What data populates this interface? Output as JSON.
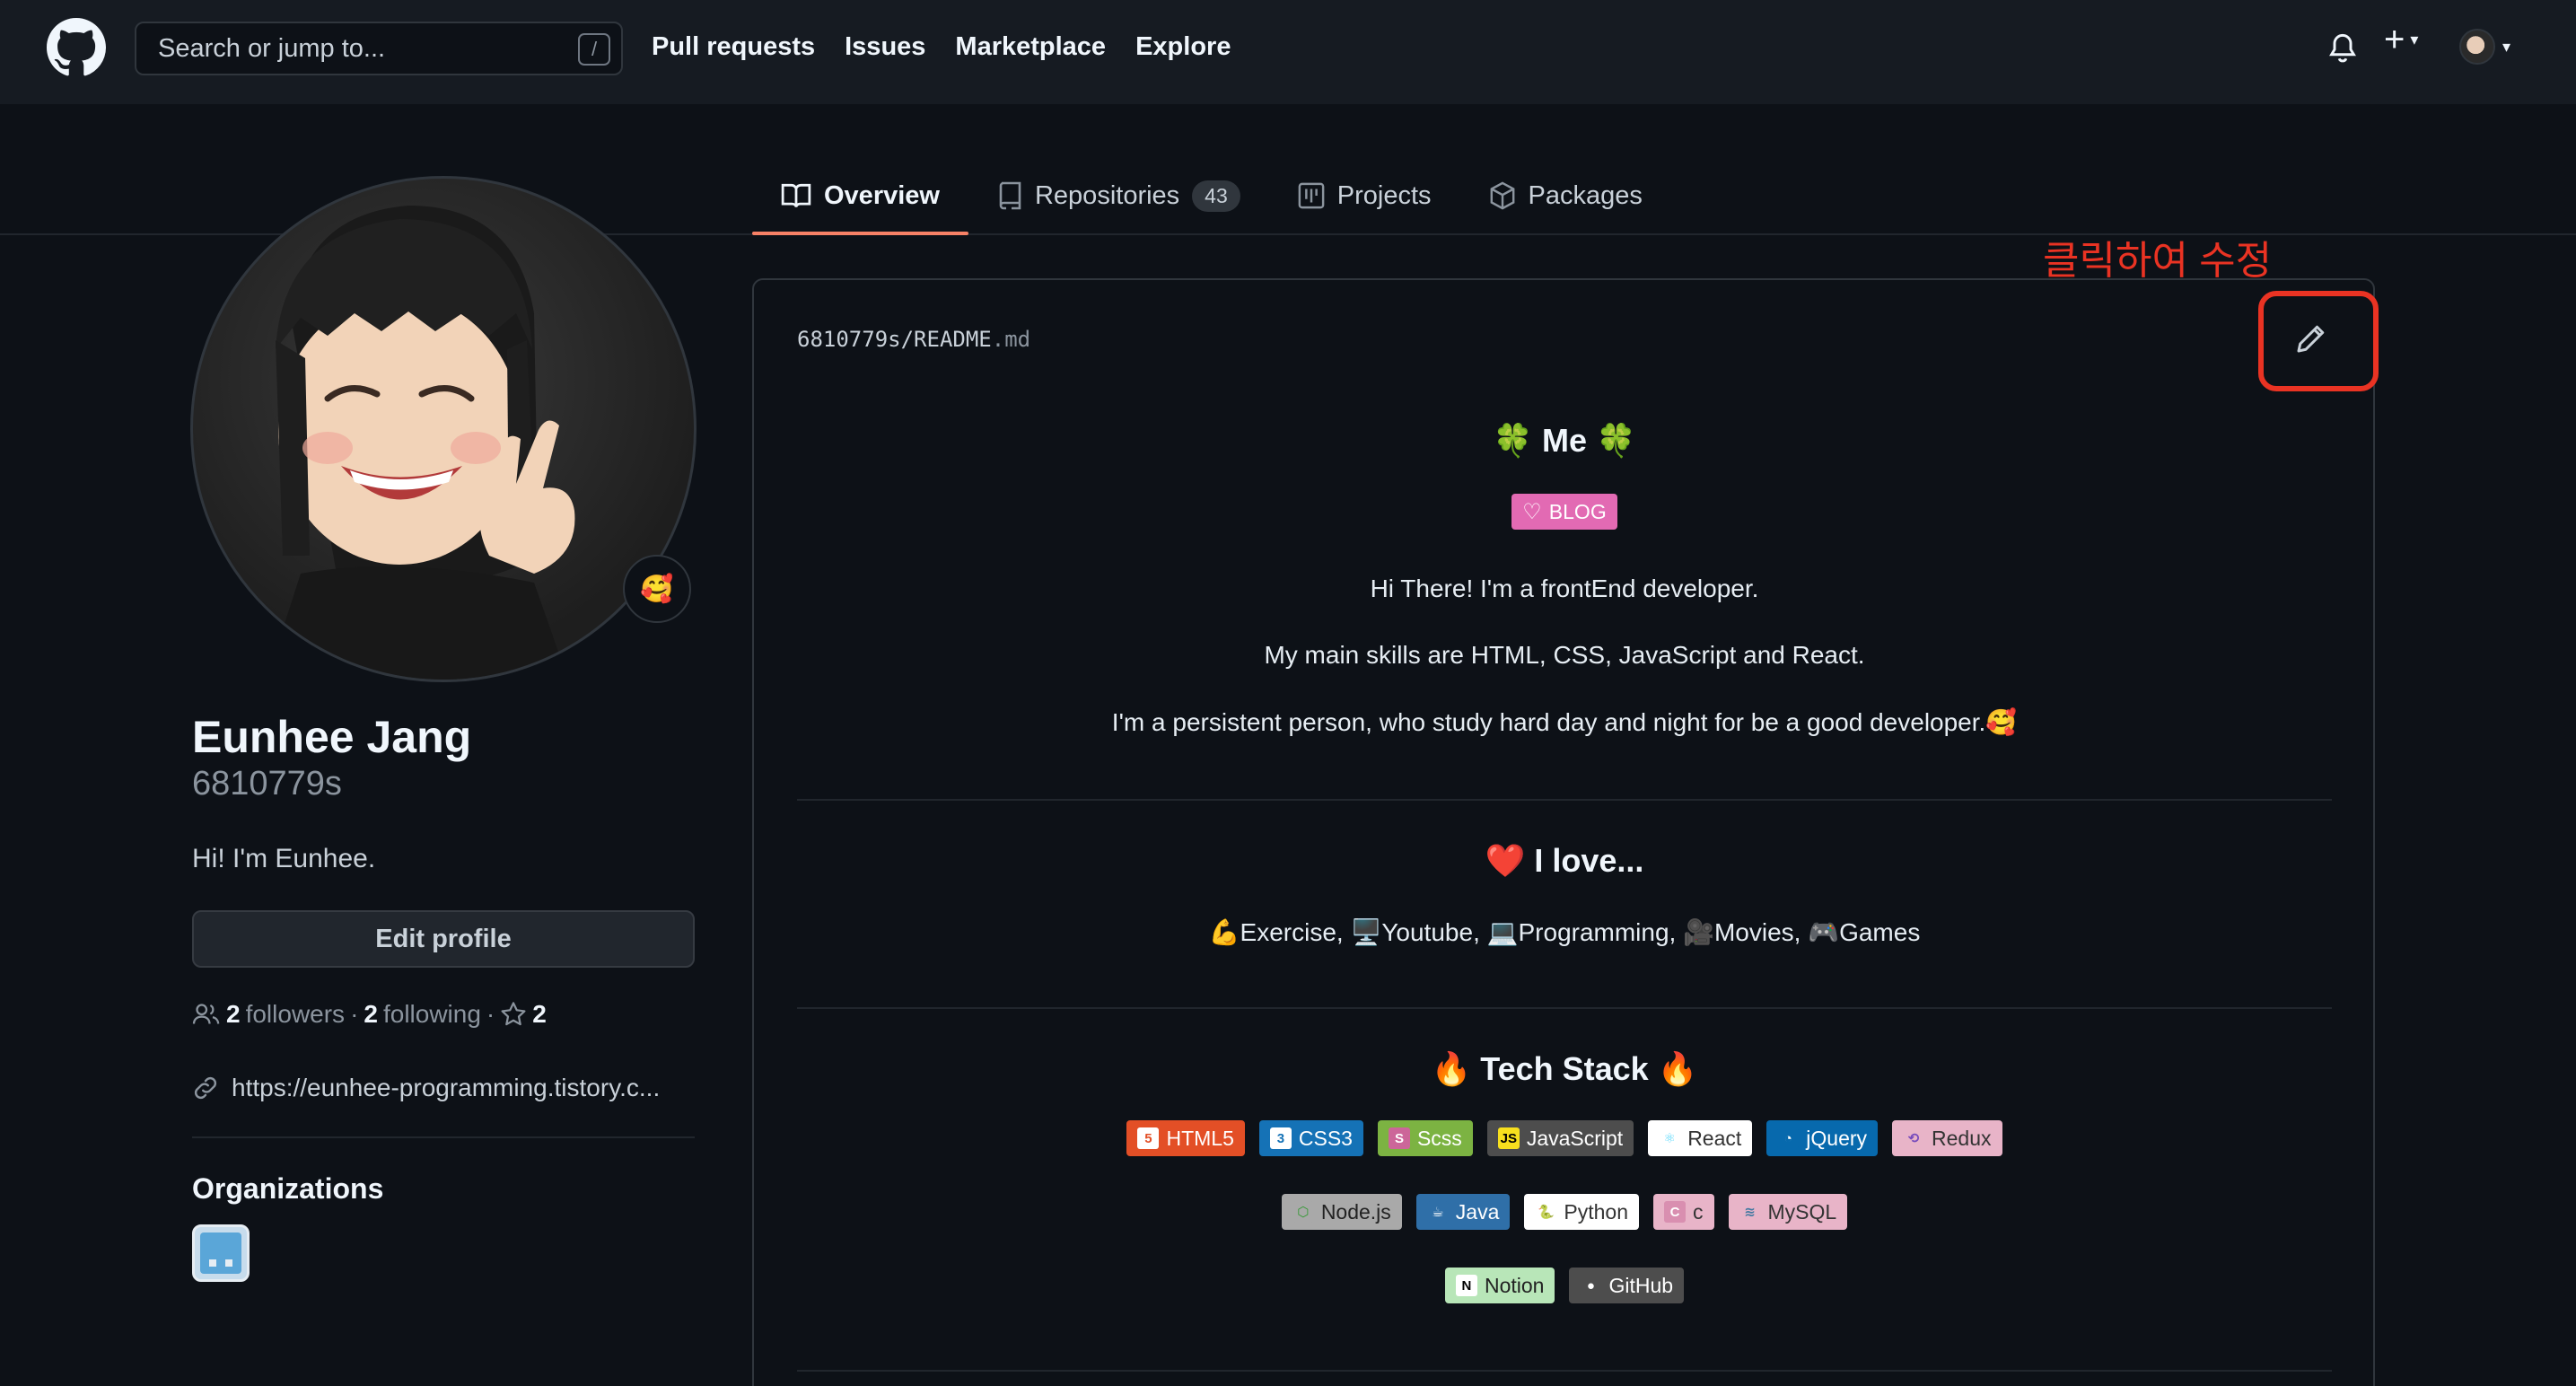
{
  "header": {
    "search_placeholder": "Search or jump to...",
    "search_shortcut": "/",
    "nav": [
      "Pull requests",
      "Issues",
      "Marketplace",
      "Explore"
    ]
  },
  "tabs": [
    {
      "label": "Overview",
      "active": true,
      "icon": "book-icon"
    },
    {
      "label": "Repositories",
      "count": "43",
      "icon": "repo-icon"
    },
    {
      "label": "Projects",
      "icon": "project-icon"
    },
    {
      "label": "Packages",
      "icon": "package-icon"
    }
  ],
  "profile": {
    "fullname": "Eunhee Jang",
    "username": "6810779s",
    "bio": "Hi! I'm Eunhee.",
    "status_emoji": "🥰",
    "edit_label": "Edit profile",
    "followers_count": "2",
    "followers_label": "followers",
    "following_count": "2",
    "following_label": "following",
    "stars_count": "2",
    "link": "https://eunhee-programming.tistory.c...",
    "orgs_title": "Organizations"
  },
  "readme": {
    "path_user": "6810779s",
    "path_sep": "/",
    "path_file": "README",
    "path_ext": ".md",
    "annotation": "클릭하여 수정",
    "me_title": "🍀 Me 🍀",
    "blog_badge": "BLOG",
    "intro1": "Hi There! I'm a frontEnd developer.",
    "intro2": "My main skills are HTML, CSS, JavaScript and React.",
    "intro3": "I'm a persistent person, who study hard day and night for be a good developer.🥰",
    "love_title": "❤️ I love...",
    "love_list": "💪Exercise,  🖥️Youtube,  💻Programming,  🎥Movies,  🎮Games",
    "tech_title": "🔥 Tech Stack 🔥",
    "tech_row1": [
      {
        "label": "HTML5",
        "bg": "#e34f26",
        "ic": "5",
        "icbg": "#ffffff",
        "icfg": "#e34f26"
      },
      {
        "label": "CSS3",
        "bg": "#1572b6",
        "ic": "3",
        "icbg": "#ffffff",
        "icfg": "#1572b6"
      },
      {
        "label": "Scss",
        "bg": "#7cb342",
        "ic": "S",
        "icbg": "#cc6699",
        "icfg": "#ffffff"
      },
      {
        "label": "JavaScript",
        "bg": "#4d4d4d",
        "ic": "JS",
        "icbg": "#f7df1e",
        "icfg": "#000000"
      },
      {
        "label": "React",
        "bg": "#ffffff",
        "fg": "#333333",
        "ic": "⚛",
        "icbg": "#ffffff",
        "icfg": "#61dafb"
      },
      {
        "label": "jQuery",
        "bg": "#0769ad",
        "ic": "◔",
        "icbg": "#0769ad",
        "icfg": "#ffffff"
      },
      {
        "label": "Redux",
        "bg": "#e8b4c8",
        "fg": "#333333",
        "ic": "⟲",
        "icbg": "#e8b4c8",
        "icfg": "#764abc"
      }
    ],
    "tech_row2": [
      {
        "label": "Node.js",
        "bg": "#a9a9a9",
        "fg": "#222222",
        "ic": "⬡",
        "icbg": "#a9a9a9",
        "icfg": "#339933"
      },
      {
        "label": "Java",
        "bg": "#2f6fa8",
        "ic": "☕",
        "icbg": "#2f6fa8",
        "icfg": "#ffffff"
      },
      {
        "label": "Python",
        "bg": "#ffffff",
        "fg": "#333333",
        "ic": "🐍",
        "icbg": "#ffffff",
        "icfg": "#3776ab"
      },
      {
        "label": "c",
        "bg": "#e8b4c8",
        "fg": "#333333",
        "ic": "C",
        "icbg": "#d98fb0",
        "icfg": "#ffffff"
      },
      {
        "label": "MySQL",
        "bg": "#e8b4c8",
        "fg": "#333333",
        "ic": "≋",
        "icbg": "#e8b4c8",
        "icfg": "#4479a1"
      }
    ],
    "tech_row3": [
      {
        "label": "Notion",
        "bg": "#b8e6b8",
        "fg": "#222222",
        "ic": "N",
        "icbg": "#ffffff",
        "icfg": "#000000"
      },
      {
        "label": "GitHub",
        "bg": "#4d4d4d",
        "ic": "●",
        "icbg": "#4d4d4d",
        "icfg": "#ffffff"
      }
    ]
  }
}
